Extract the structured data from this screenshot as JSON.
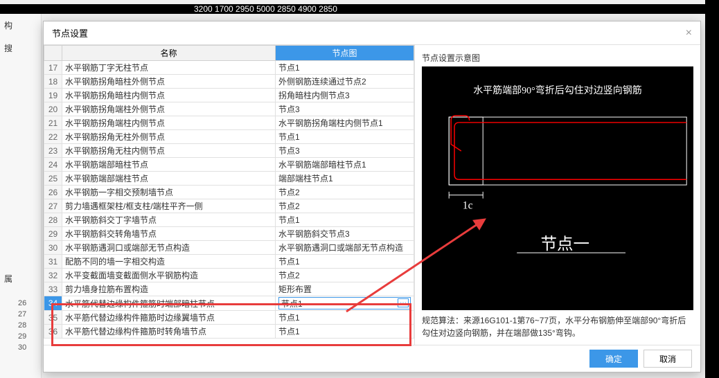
{
  "cad_top_ticks": "3200    1700    2950           5000           2850          4900                2850",
  "left_panel": {
    "label1": "构",
    "label2": "搜",
    "label3": "属"
  },
  "left_rows": [
    "26",
    "27",
    "28",
    "29",
    "30"
  ],
  "dialog": {
    "title": "节点设置",
    "close": "×",
    "headers": {
      "name": "名称",
      "node": "节点图"
    },
    "rows": [
      {
        "n": 17,
        "name": "水平钢筋丁字无柱节点",
        "val": "节点1"
      },
      {
        "n": 18,
        "name": "水平钢筋拐角暗柱外侧节点",
        "val": "外侧钢筋连续通过节点2"
      },
      {
        "n": 19,
        "name": "水平钢筋拐角暗柱内侧节点",
        "val": "拐角暗柱内侧节点3"
      },
      {
        "n": 20,
        "name": "水平钢筋拐角端柱外侧节点",
        "val": "节点3"
      },
      {
        "n": 21,
        "name": "水平钢筋拐角端柱内侧节点",
        "val": "水平钢筋拐角端柱内侧节点1"
      },
      {
        "n": 22,
        "name": "水平钢筋拐角无柱外侧节点",
        "val": "节点1"
      },
      {
        "n": 23,
        "name": "水平钢筋拐角无柱内侧节点",
        "val": "节点3"
      },
      {
        "n": 24,
        "name": "水平钢筋端部暗柱节点",
        "val": "水平钢筋端部暗柱节点1"
      },
      {
        "n": 25,
        "name": "水平钢筋端部端柱节点",
        "val": "端部端柱节点1"
      },
      {
        "n": 26,
        "name": "水平钢筋一字相交预制墙节点",
        "val": "节点2"
      },
      {
        "n": 27,
        "name": "剪力墙遇框架柱/框支柱/端柱平齐一侧",
        "val": "节点2"
      },
      {
        "n": 28,
        "name": "水平钢筋斜交丁字墙节点",
        "val": "节点1"
      },
      {
        "n": 29,
        "name": "水平钢筋斜交转角墙节点",
        "val": "水平钢筋斜交节点3"
      },
      {
        "n": 30,
        "name": "水平钢筋遇洞口或端部无节点构造",
        "val": "水平钢筋遇洞口或端部无节点构造"
      },
      {
        "n": 31,
        "name": "配筋不同的墙一字相交构造",
        "val": "节点1"
      },
      {
        "n": 32,
        "name": "水平变截面墙变截面侧水平钢筋构造",
        "val": "节点2"
      },
      {
        "n": 33,
        "name": "剪力墙身拉筋布置构造",
        "val": "矩形布置"
      },
      {
        "n": 34,
        "name": "水平筋代替边缘构件箍筋时端部暗柱节点",
        "val": "节点1",
        "selected": true,
        "editing": true
      },
      {
        "n": 35,
        "name": "水平筋代替边缘构件箍筋时边缘翼墙节点",
        "val": "节点1"
      },
      {
        "n": 36,
        "name": "水平筋代替边缘构件箍筋时转角墙节点",
        "val": "节点1"
      }
    ],
    "preview": {
      "title": "节点设置示意图",
      "heading": "水平筋端部90°弯折后勾住对边竖向钢筋",
      "dim": "1c",
      "label": "节点一",
      "rule": "规范算法：来源16G101-1第76~77页，水平分布钢筋伸至端部90°弯折后勾住对边竖向钢筋，并在端部做135°弯钩。"
    },
    "footer": {
      "ok": "确定",
      "cancel": "取消"
    }
  }
}
